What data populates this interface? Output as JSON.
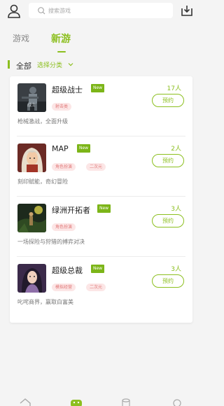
{
  "search": {
    "placeholder": "搜索游戏"
  },
  "tabs": [
    {
      "label": "游戏"
    },
    {
      "label": "新游"
    }
  ],
  "filter": {
    "all_label": "全部",
    "select_label": "选择分类"
  },
  "games": [
    {
      "title": "超级战士",
      "badge": "New",
      "tags": [
        "射击类"
      ],
      "description": "枪械激战，全面升级",
      "count": "17人",
      "button": "预约",
      "thumb_icon": "soldier-thumbnail"
    },
    {
      "title": "MAP",
      "badge": "New",
      "tags": [
        "角色扮演",
        "二次元"
      ],
      "description": "刻印赋能，奇幻冒险",
      "count": "2人",
      "button": "预约",
      "thumb_icon": "anime-girl-thumbnail"
    },
    {
      "title": "绿洲开拓者",
      "badge": "New",
      "tags": [
        "角色扮演"
      ],
      "description": "一场探险与狩猎的搏弈对决",
      "count": "3人",
      "button": "预约",
      "thumb_icon": "explorer-thumbnail"
    },
    {
      "title": "超级总裁",
      "badge": "New",
      "tags": [
        "模拟经营",
        "二次元"
      ],
      "description": "叱咤商界，赢取白富美",
      "count": "3人",
      "button": "预约",
      "thumb_icon": "ceo-girl-thumbnail"
    }
  ],
  "colors": {
    "accent": "#8cbf1f",
    "badge": "#7cb518",
    "tag_bg": "#fce6e6",
    "tag_text": "#e07a7a"
  }
}
